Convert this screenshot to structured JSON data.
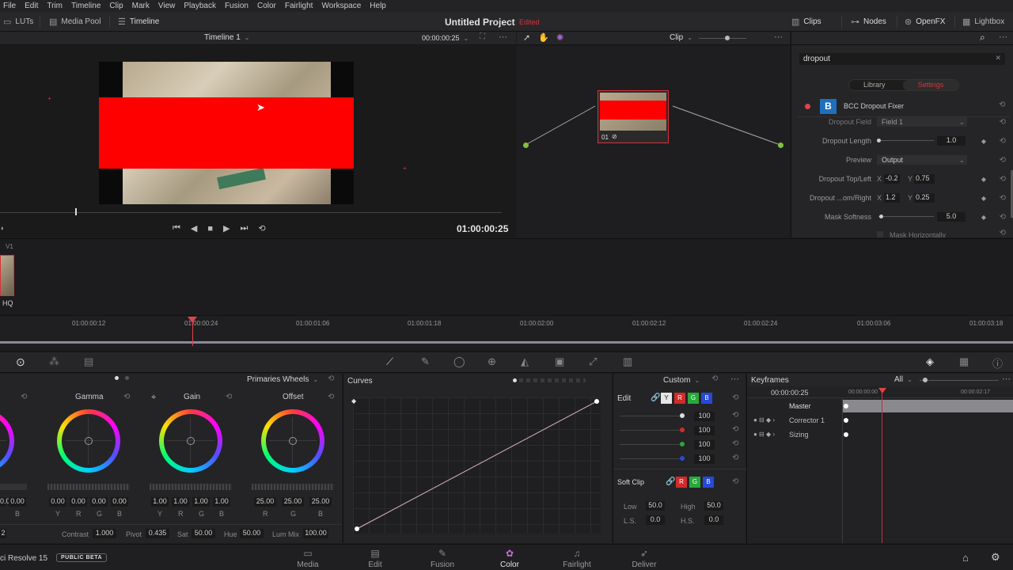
{
  "menu": [
    "File",
    "Edit",
    "Trim",
    "Timeline",
    "Clip",
    "Mark",
    "View",
    "Playback",
    "Fusion",
    "Color",
    "Fairlight",
    "Workspace",
    "Help"
  ],
  "toolbar": {
    "luts": "LUTs",
    "media_pool": "Media Pool",
    "timeline": "Timeline",
    "project_title": "Untitled Project",
    "project_status": "Edited",
    "clips": "Clips",
    "nodes": "Nodes",
    "openfx": "OpenFX",
    "lightbox": "Lightbox"
  },
  "viewer": {
    "timeline_name": "Timeline 1",
    "timecode_top": "00:00:00:25",
    "timecode": "01:00:00:25"
  },
  "nodes_panel": {
    "mode": "Clip",
    "node_label": "01"
  },
  "openfx": {
    "search_value": "dropout",
    "tab_library": "Library",
    "tab_settings": "Settings",
    "plugin_name": "BCC Dropout Fixer",
    "rows": [
      {
        "label": "Dropout Field",
        "value": "Field 1"
      },
      {
        "label": "Dropout Length",
        "value": "1.0"
      },
      {
        "label": "Preview",
        "value": "Output"
      },
      {
        "label": "Dropout Top/Left",
        "x": "-0.2",
        "y": "0.75"
      },
      {
        "label": "Dropout ...om/Right",
        "x": "1.2",
        "y": "0.25"
      },
      {
        "label": "Mask Softness",
        "value": "5.0"
      },
      {
        "label": "Mask Horizontally"
      }
    ],
    "x_label": "X",
    "y_label": "Y"
  },
  "clips_strip": {
    "track": "V1",
    "clip_label": "HQ"
  },
  "ruler": {
    "ticks": [
      "01:00:00:12",
      "01:00:00:24",
      "01:00:01:06",
      "01:00:01:18",
      "01:00:02:00",
      "01:00:02:12",
      "01:00:02:24",
      "01:00:03:06",
      "01:00:03:18"
    ]
  },
  "wheels": {
    "title": "Primaries Wheels",
    "wheels": [
      {
        "name": "Gamma",
        "values": [
          "0.00",
          "0.00",
          "0.00",
          "0.00"
        ],
        "channels": [
          "Y",
          "R",
          "G",
          "B"
        ]
      },
      {
        "name": "Gain",
        "values": [
          "1.00",
          "1.00",
          "1.00",
          "1.00"
        ],
        "channels": [
          "Y",
          "R",
          "G",
          "B"
        ]
      },
      {
        "name": "Offset",
        "values": [
          "25.00",
          "25.00",
          "25.00"
        ],
        "channels": [
          "R",
          "G",
          "B"
        ]
      }
    ],
    "left_values": [
      "0.00",
      "0.00"
    ],
    "left_channel": "B",
    "bottom": {
      "first": "2",
      "contrast_label": "Contrast",
      "contrast": "1.000",
      "pivot_label": "Pivot",
      "pivot": "0.435",
      "sat_label": "Sat",
      "sat": "50.00",
      "hue_label": "Hue",
      "hue": "50.00",
      "lummix_label": "Lum Mix",
      "lummix": "100.00"
    }
  },
  "curves": {
    "title": "Curves",
    "mode": "Custom"
  },
  "edit_panel": {
    "title": "Edit",
    "channels": [
      "Y",
      "R",
      "G",
      "B"
    ],
    "values": [
      "100",
      "100",
      "100",
      "100"
    ],
    "softclip_title": "Soft Clip",
    "low_label": "Low",
    "low": "50.0",
    "high_label": "High",
    "high": "50.0",
    "ls_label": "L.S.",
    "ls": "0.0",
    "hs_label": "H.S.",
    "hs": "0.0"
  },
  "keyframes": {
    "title": "Keyframes",
    "filter": "All",
    "timecode": "00:00:00:25",
    "ruler_a": "00:00:00:00",
    "ruler_b": "00:00:02:17",
    "tracks": [
      "Master",
      "Corrector 1",
      "Sizing"
    ]
  },
  "pages": {
    "app_name": "ci Resolve 15",
    "badge": "PUBLIC BETA",
    "items": [
      "Media",
      "Edit",
      "Fusion",
      "Color",
      "Fairlight",
      "Deliver"
    ],
    "active": "Color"
  },
  "colors": {
    "accent": "#e0434a",
    "red_box": "#ff0000"
  }
}
